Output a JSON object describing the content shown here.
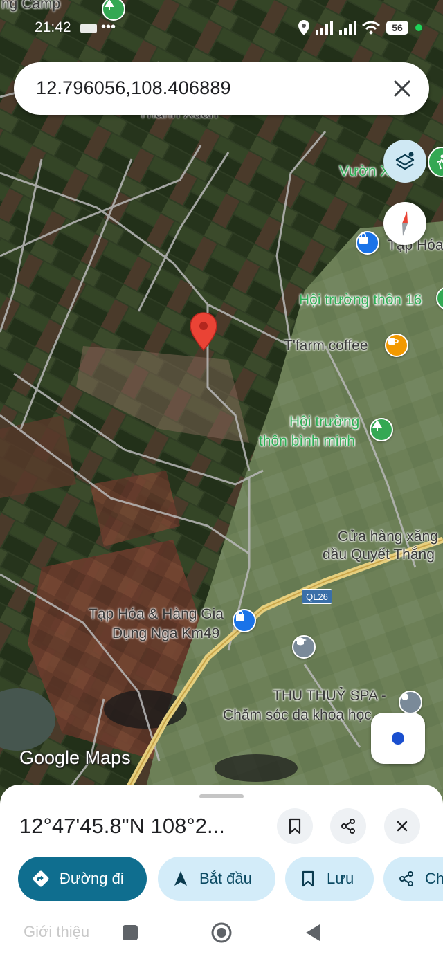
{
  "status_bar": {
    "time": "21:42",
    "battery": "56"
  },
  "search": {
    "value": "12.796056,108.406889"
  },
  "map": {
    "labels": {
      "camp": "ng Camp",
      "thanh_xuan": "Thanh Xuân",
      "vuon": "Vườn X",
      "tap_hoa": "Tạp Hóa",
      "hoi_truong_16": "Hội trường thôn 16",
      "tfarm": "T'farm coffee",
      "hoi_truong_bm_1": "Hội trường",
      "hoi_truong_bm_2": "thôn bình minh",
      "cua_hang_1": "Cửa hàng xăng",
      "cua_hang_2": "dầu Quyết Thắng",
      "tap_hoa_nga_1": "Tạp Hóa & Hàng Gia",
      "tap_hoa_nga_2": "Dụng Nga Km49",
      "spa_1": "THU THUỶ SPA -",
      "spa_2": "Chăm sóc da khoa học",
      "road_shield": "QL26"
    },
    "logo": "Google Maps"
  },
  "sheet": {
    "title": "12°47'45.8\"N 108°2...",
    "chips": {
      "directions": "Đường đi",
      "start": "Bắt đầu",
      "save": "Lưu",
      "share": "Ch"
    },
    "faded_tab": "Giới thiệu"
  },
  "colors": {
    "primary_chip": "#0f6e8f",
    "secondary_chip": "#d3ecf9",
    "pin": "#ea4335",
    "poi_green": "#34a853",
    "poi_blue": "#1a73e8",
    "poi_orange": "#f29900",
    "poi_gray": "#7a8a99"
  }
}
